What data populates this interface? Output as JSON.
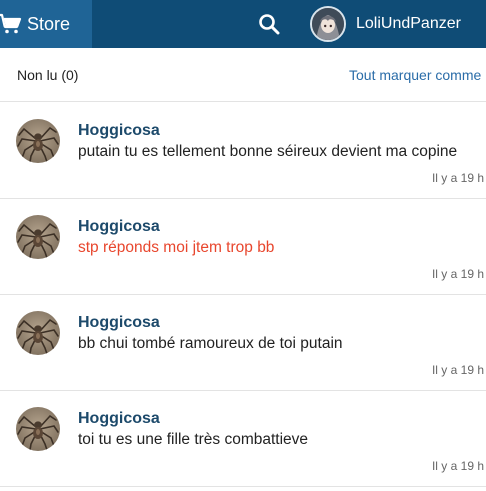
{
  "header": {
    "store_label": "Store",
    "username": "LoliUndPanzer",
    "icons": {
      "cart": "cart-icon",
      "search": "search-icon",
      "avatar": "user-avatar"
    },
    "colors": {
      "bar": "#0f4c76",
      "active_tab": "#1f6496"
    }
  },
  "subheader": {
    "unread_label": "Non lu (0)",
    "mark_all_label": "Tout marquer comme"
  },
  "notifications": [
    {
      "author": "Hoggicosa",
      "message": "putain tu es tellement bonne séireux devient ma copine",
      "time": "Il y a 19 h",
      "highlight": false
    },
    {
      "author": "Hoggicosa",
      "message": "stp réponds moi jtem trop bb",
      "time": "Il y a 19 h",
      "highlight": true
    },
    {
      "author": "Hoggicosa",
      "message": "bb chui tombé ramoureux de toi putain",
      "time": "Il y a 19 h",
      "highlight": false
    },
    {
      "author": "Hoggicosa",
      "message": "toi tu es une fille très combattieve",
      "time": "Il y a 19 h",
      "highlight": false
    }
  ],
  "colors": {
    "author": "#1d4a6b",
    "highlight_text": "#e8462d",
    "link": "#2a6ca8"
  }
}
